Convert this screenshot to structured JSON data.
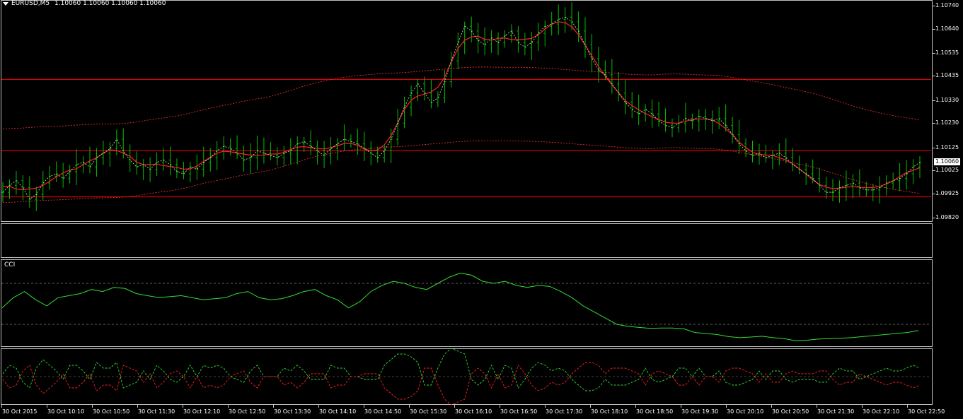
{
  "header": {
    "symbol_label": "EURUSD,M5",
    "ohlc_text": "1.10060 1.10060 1.10060 1.10060"
  },
  "price_axis": {
    "labels": [
      "1.10740",
      "1.10640",
      "1.10535",
      "1.10435",
      "1.10330",
      "1.10230",
      "1.10125",
      "1.10025",
      "1.09925",
      "1.09820"
    ],
    "current": "1.10060"
  },
  "time_axis": {
    "labels": [
      "30 Oct 2015",
      "30 Oct 10:10",
      "30 Oct 10:50",
      "30 Oct 11:30",
      "30 Oct 12:10",
      "30 Oct 12:50",
      "30 Oct 13:30",
      "30 Oct 14:10",
      "30 Oct 14:50",
      "30 Oct 15:30",
      "30 Oct 16:10",
      "30 Oct 16:50",
      "30 Oct 17:30",
      "30 Oct 18:10",
      "30 Oct 18:50",
      "30 Oct 19:30",
      "30 Oct 20:10",
      "30 Oct 20:50",
      "30 Oct 21:30",
      "30 Oct 22:10",
      "30 Oct 22:50"
    ]
  },
  "indicators": {
    "cci_label": "CCI"
  },
  "colors": {
    "background": "#000000",
    "bars": "#00c000",
    "moving_average": "#ff2020",
    "horizontal_levels": "#ff0000",
    "envelope": "#ff3030",
    "cci_line": "#33dd33",
    "grid_frame": "#bfbfbf"
  },
  "chart_data": {
    "type": "line",
    "title": "EURUSD,M5",
    "ylim": [
      1.0982,
      1.1074
    ],
    "horizontal_levels": [
      1.1042,
      1.1011,
      1.0991
    ],
    "close": [
      1.0993,
      1.0996,
      1.0998,
      1.0995,
      1.099,
      1.0992,
      1.0997,
      1.1,
      1.1001,
      1.0999,
      1.1002,
      1.1005,
      1.1006,
      1.1004,
      1.1008,
      1.101,
      1.1012,
      1.1016,
      1.1011,
      1.1007,
      1.1004,
      1.1005,
      1.1003,
      1.1006,
      1.1007,
      1.1005,
      1.1002,
      1.1001,
      1.1004,
      1.1003,
      1.1006,
      1.1008,
      1.1011,
      1.1013,
      1.1012,
      1.101,
      1.1007,
      1.1008,
      1.1011,
      1.101,
      1.1009,
      1.1008,
      1.101,
      1.1011,
      1.1014,
      1.1015,
      1.1013,
      1.1011,
      1.1009,
      1.1012,
      1.1014,
      1.1016,
      1.1015,
      1.1014,
      1.1012,
      1.101,
      1.1008,
      1.1011,
      1.1016,
      1.1023,
      1.103,
      1.1036,
      1.104,
      1.1036,
      1.1032,
      1.1034,
      1.1041,
      1.105,
      1.1058,
      1.1065,
      1.1063,
      1.1059,
      1.1057,
      1.106,
      1.1058,
      1.1061,
      1.1063,
      1.1058,
      1.1056,
      1.1058,
      1.1062,
      1.1065,
      1.1066,
      1.1068,
      1.1069,
      1.1067,
      1.1063,
      1.1057,
      1.1051,
      1.1046,
      1.1044,
      1.104,
      1.1036,
      1.1032,
      1.1029,
      1.1027,
      1.1029,
      1.1027,
      1.1024,
      1.1022,
      1.1021,
      1.1023,
      1.1025,
      1.1024,
      1.1026,
      1.1025,
      1.1024,
      1.1025,
      1.1022,
      1.1018,
      1.1014,
      1.1011,
      1.1009,
      1.101,
      1.1008,
      1.1009,
      1.101,
      1.1008,
      1.1005,
      1.1003,
      1.1001,
      1.0999,
      1.0996,
      1.0993,
      1.0993,
      1.0995,
      1.0996,
      1.0997,
      1.0995,
      1.0994,
      1.0994,
      1.0995,
      1.0997,
      1.0998,
      1.0999,
      1.1001,
      1.1004,
      1.1006
    ],
    "cci": [
      -20,
      30,
      60,
      20,
      -10,
      30,
      40,
      50,
      70,
      60,
      80,
      75,
      50,
      40,
      30,
      35,
      40,
      30,
      20,
      25,
      30,
      50,
      60,
      30,
      20,
      25,
      40,
      60,
      70,
      40,
      20,
      -20,
      10,
      60,
      90,
      110,
      100,
      80,
      70,
      100,
      130,
      150,
      140,
      110,
      100,
      110,
      90,
      80,
      90,
      85,
      60,
      30,
      -10,
      -40,
      -70,
      -100,
      -110,
      -115,
      -120,
      -118,
      -118,
      -122,
      -140,
      -145,
      -150,
      -160,
      -165,
      -162,
      -158,
      -165,
      -170,
      -180,
      -178,
      -172,
      -170,
      -168,
      -165,
      -160,
      -155,
      -150,
      -145,
      -140,
      -130
    ],
    "cci_levels": [
      100,
      -100
    ]
  }
}
